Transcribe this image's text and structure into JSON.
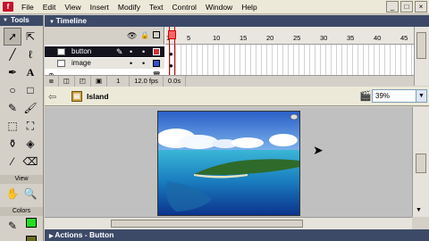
{
  "menubar": {
    "items": [
      "File",
      "Edit",
      "View",
      "Insert",
      "Modify",
      "Text",
      "Control",
      "Window",
      "Help"
    ]
  },
  "window_controls": [
    "_",
    "□",
    "×"
  ],
  "tools": {
    "title": "Tools",
    "view_label": "View",
    "colors_label": "Colors",
    "fill_color": "#22dd22"
  },
  "timeline": {
    "title": "Timeline",
    "frame_numbers": [
      "1",
      "5",
      "10",
      "15",
      "20",
      "25",
      "30",
      "35",
      "40",
      "45"
    ],
    "layers": [
      {
        "name": "button",
        "selected": true
      },
      {
        "name": "image",
        "selected": false
      }
    ],
    "status": {
      "current_frame": "1",
      "fps": "12.0 fps",
      "time": "0.0s"
    }
  },
  "editbar": {
    "scene_name": "Island",
    "zoom": "39%"
  },
  "actions": {
    "title": "Actions - Button"
  }
}
